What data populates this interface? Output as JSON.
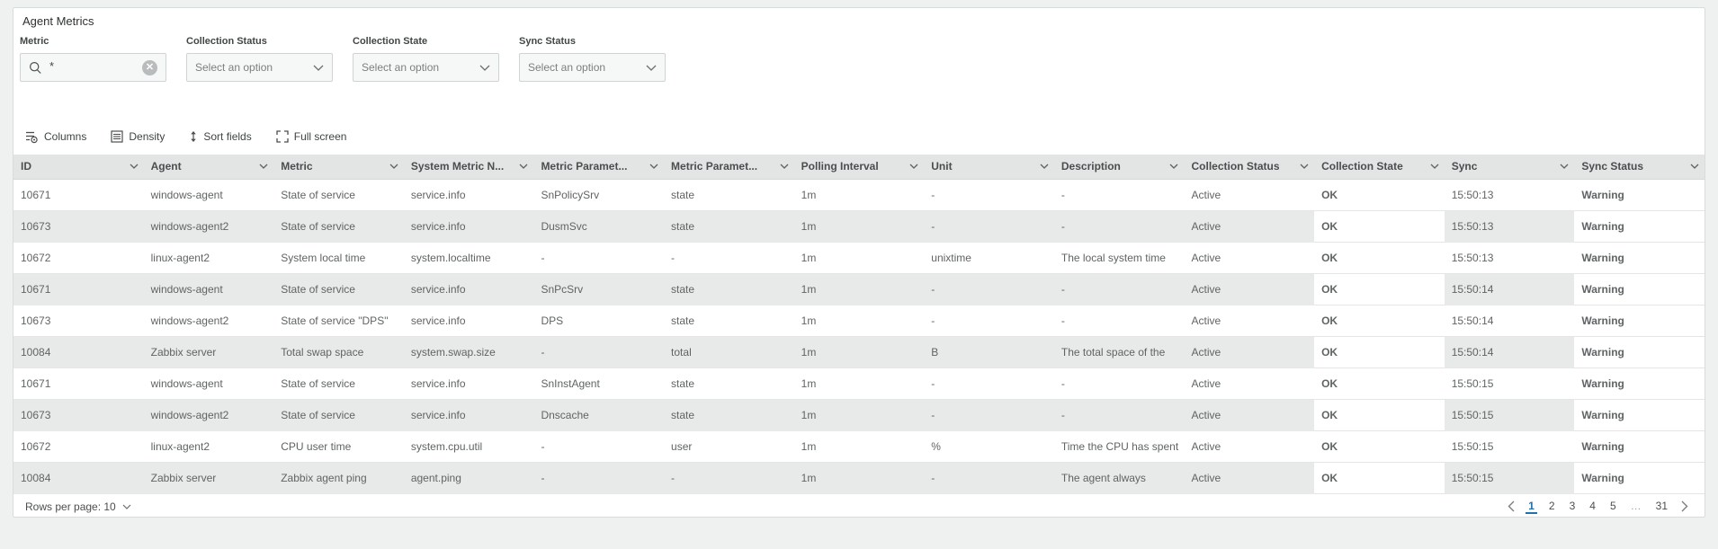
{
  "panel": {
    "title": "Agent Metrics"
  },
  "filters": [
    {
      "label": "Metric",
      "type": "search",
      "value": "*",
      "icons": [
        "search-icon",
        "clear-circle-x-icon"
      ]
    },
    {
      "label": "Collection Status",
      "type": "select",
      "placeholder": "Select an option",
      "icons": [
        "chevron-down-icon"
      ]
    },
    {
      "label": "Collection State",
      "type": "select",
      "placeholder": "Select an option",
      "icons": [
        "chevron-down-icon"
      ]
    },
    {
      "label": "Sync Status",
      "type": "select",
      "placeholder": "Select an option",
      "icons": [
        "chevron-down-icon"
      ]
    }
  ],
  "toolbar": {
    "columns_label": "Columns",
    "density_label": "Density",
    "sort_fields_label": "Sort fields",
    "full_screen_label": "Full screen",
    "icons": [
      "columns-gear-icon",
      "density-list-icon",
      "sort-arrows-icon",
      "fullscreen-icon"
    ]
  },
  "table": {
    "columns": [
      "ID",
      "Agent",
      "Metric",
      "System Metric N...",
      "Metric Paramet...",
      "Metric Paramet...",
      "Polling Interval",
      "Unit",
      "Description",
      "Collection Status",
      "Collection State",
      "Sync",
      "Sync Status"
    ],
    "column_keys": [
      "id",
      "agent",
      "metric",
      "system-metric-name",
      "metric-parameter-1",
      "metric-parameter-2",
      "polling-interval",
      "unit",
      "description",
      "collection-status",
      "collection-state",
      "sync",
      "sync-status"
    ],
    "rows": [
      [
        "10671",
        "windows-agent",
        "State of service",
        "service.info",
        "SnPolicySrv",
        "state",
        "1m",
        "-",
        "-",
        "Active",
        "OK",
        "15:50:13",
        "Warning"
      ],
      [
        "10673",
        "windows-agent2",
        "State of service",
        "service.info",
        "DusmSvc",
        "state",
        "1m",
        "-",
        "-",
        "Active",
        "OK",
        "15:50:13",
        "Warning"
      ],
      [
        "10672",
        "linux-agent2",
        "System local time",
        "system.localtime",
        "-",
        "-",
        "1m",
        "unixtime",
        "The local system time",
        "Active",
        "OK",
        "15:50:13",
        "Warning"
      ],
      [
        "10671",
        "windows-agent",
        "State of service",
        "service.info",
        "SnPcSrv",
        "state",
        "1m",
        "-",
        "-",
        "Active",
        "OK",
        "15:50:14",
        "Warning"
      ],
      [
        "10673",
        "windows-agent2",
        "State of service \"DPS\"",
        "service.info",
        "DPS",
        "state",
        "1m",
        "-",
        "-",
        "Active",
        "OK",
        "15:50:14",
        "Warning"
      ],
      [
        "10084",
        "Zabbix server",
        "Total swap space",
        "system.swap.size",
        "-",
        "total",
        "1m",
        "B",
        "The total space of the",
        "Active",
        "OK",
        "15:50:14",
        "Warning"
      ],
      [
        "10671",
        "windows-agent",
        "State of service",
        "service.info",
        "SnInstAgent",
        "state",
        "1m",
        "-",
        "-",
        "Active",
        "OK",
        "15:50:15",
        "Warning"
      ],
      [
        "10673",
        "windows-agent2",
        "State of service",
        "service.info",
        "Dnscache",
        "state",
        "1m",
        "-",
        "-",
        "Active",
        "OK",
        "15:50:15",
        "Warning"
      ],
      [
        "10672",
        "linux-agent2",
        "CPU user time",
        "system.cpu.util",
        "-",
        "user",
        "1m",
        "%",
        "Time the CPU has spent",
        "Active",
        "OK",
        "15:50:15",
        "Warning"
      ],
      [
        "10084",
        "Zabbix server",
        "Zabbix agent ping",
        "agent.ping",
        "-",
        "-",
        "1m",
        "-",
        "The agent always",
        "Active",
        "OK",
        "15:50:15",
        "Warning"
      ]
    ]
  },
  "footer": {
    "rows_per_page_label": "Rows per page: 10",
    "pagination": {
      "pages": [
        "1",
        "2",
        "3",
        "4",
        "5",
        "…",
        "31"
      ],
      "active": "1",
      "ellipsis": "…"
    }
  },
  "colors": {
    "ok_green": "#3e8c43",
    "warning_red": "#d95045",
    "active_green": "#459a44",
    "pagination_active_blue": "#2470a8"
  }
}
